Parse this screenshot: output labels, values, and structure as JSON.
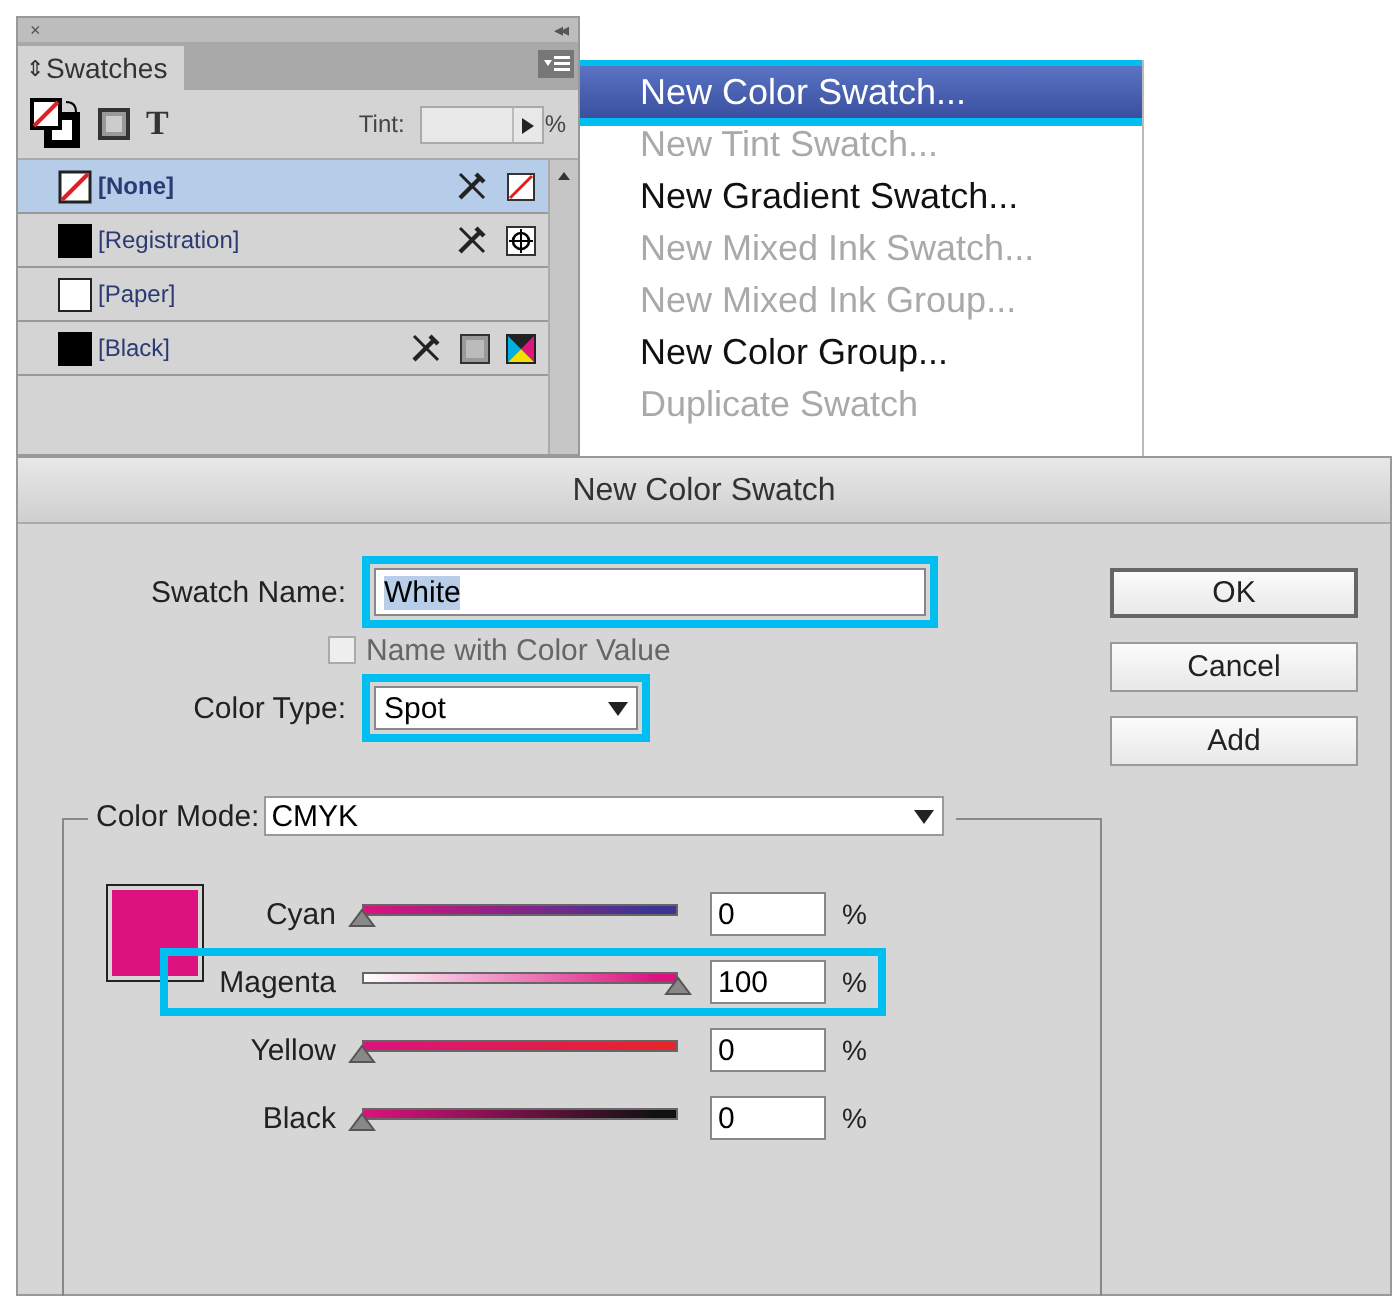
{
  "panel": {
    "close_glyph": "×",
    "collapse_glyph": "◂◂",
    "tab": {
      "label": "Swatches",
      "arrows": "⇕"
    },
    "tint_label": "Tint:",
    "tint_unit": "%",
    "type_glyph": "T",
    "swatches": [
      {
        "name": "[None]",
        "kind": "none",
        "selected": true
      },
      {
        "name": "[Registration]",
        "kind": "registration",
        "selected": false
      },
      {
        "name": "[Paper]",
        "kind": "paper",
        "selected": false
      },
      {
        "name": "[Black]",
        "kind": "process",
        "selected": false
      }
    ]
  },
  "menu": {
    "items": [
      {
        "label": "New Color Swatch...",
        "disabled": false,
        "selected": true,
        "callout": true
      },
      {
        "label": "New Tint Swatch...",
        "disabled": true,
        "selected": false,
        "callout": false
      },
      {
        "label": "New Gradient Swatch...",
        "disabled": false,
        "selected": false,
        "callout": false
      },
      {
        "label": "New Mixed Ink Swatch...",
        "disabled": true,
        "selected": false,
        "callout": false
      },
      {
        "label": "New Mixed Ink Group...",
        "disabled": true,
        "selected": false,
        "callout": false
      },
      {
        "label": "New Color Group...",
        "disabled": false,
        "selected": false,
        "callout": false
      },
      {
        "label": "Duplicate Swatch",
        "disabled": true,
        "selected": false,
        "callout": false
      }
    ]
  },
  "dialog": {
    "title": "New Color Swatch",
    "swatch_name": {
      "label": "Swatch Name:",
      "value": "White",
      "callout": true
    },
    "name_with_value": {
      "label": "Name with Color Value",
      "checked": false,
      "disabled": true
    },
    "color_type": {
      "label": "Color Type:",
      "value": "Spot",
      "callout": true
    },
    "color_mode": {
      "label": "Color Mode:",
      "value": "CMYK"
    },
    "preview": {
      "color": "#dc127f"
    },
    "channels": [
      {
        "name": "Cyan",
        "level": 0,
        "value": "0",
        "unit": "%",
        "kind": "mix",
        "color": "#3a3592",
        "callout": false
      },
      {
        "name": "Magenta",
        "level": 1,
        "value": "100",
        "unit": "%",
        "kind": "own",
        "color": "#dc127f",
        "callout": true
      },
      {
        "name": "Yellow",
        "level": 0,
        "value": "0",
        "unit": "%",
        "kind": "mix",
        "color": "#e5242c",
        "callout": false
      },
      {
        "name": "Black",
        "level": 0,
        "value": "0",
        "unit": "%",
        "kind": "mix",
        "color": "#111111",
        "callout": false
      }
    ],
    "buttons": [
      {
        "label": "OK",
        "default": true
      },
      {
        "label": "Cancel",
        "default": false
      },
      {
        "label": "Add",
        "default": false
      }
    ]
  }
}
